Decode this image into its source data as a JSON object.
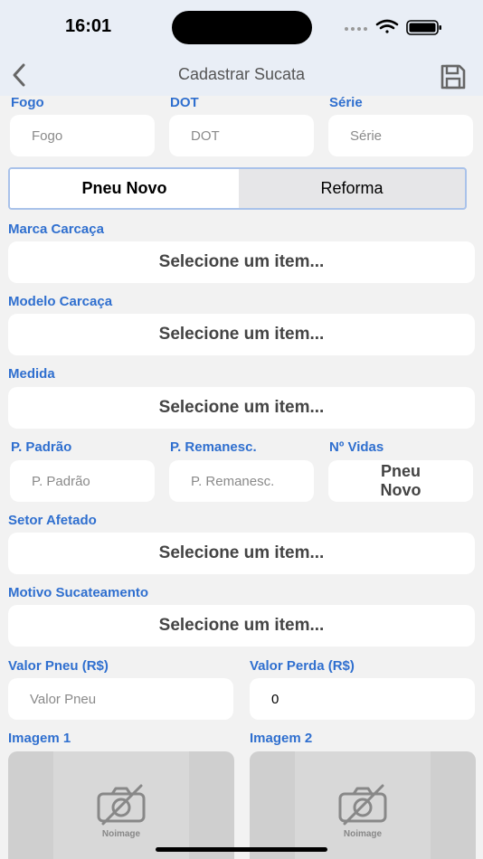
{
  "status_bar": {
    "time": "16:01"
  },
  "nav": {
    "title": "Cadastrar Sucata"
  },
  "row1": {
    "fogo_label": "Fogo",
    "fogo_placeholder": "Fogo",
    "dot_label": "DOT",
    "dot_placeholder": "DOT",
    "serie_label": "Série",
    "serie_placeholder": "Série"
  },
  "segment": {
    "option_1": "Pneu Novo",
    "option_2": "Reforma",
    "selected": "Pneu Novo"
  },
  "marca": {
    "label": "Marca Carcaça",
    "value": "Selecione um item..."
  },
  "modelo": {
    "label": "Modelo Carcaça",
    "value": "Selecione um item..."
  },
  "medida": {
    "label": "Medida",
    "value": "Selecione um item..."
  },
  "row2": {
    "padrao_label": "P. Padrão",
    "padrao_placeholder": "P. Padrão",
    "remanesc_label": "P. Remanesc.",
    "remanesc_placeholder": "P. Remanesc.",
    "vidas_label": "Nº Vidas",
    "vidas_value": "Pneu Novo"
  },
  "setor": {
    "label": "Setor Afetado",
    "value": "Selecione um item..."
  },
  "motivo": {
    "label": "Motivo Sucateamento",
    "value": "Selecione um item..."
  },
  "valores": {
    "pneu_label": "Valor Pneu  (R$)",
    "pneu_placeholder": "Valor Pneu",
    "perda_label": "Valor Perda  (R$)",
    "perda_value": "0"
  },
  "imagens": {
    "img1_label": "Imagem 1",
    "img2_label": "Imagem 2",
    "noimage_text": "Noimage"
  },
  "colors": {
    "accent": "#2f6fcf",
    "nav_bg": "#e9eef6",
    "page_bg": "#f2f2f2"
  }
}
